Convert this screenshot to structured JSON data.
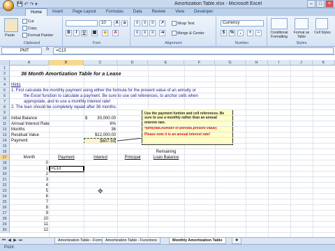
{
  "window": {
    "title": "Amortization Table.xlsx - Microsoft Excel"
  },
  "ribbon_tabs": [
    "Home",
    "Insert",
    "Page Layout",
    "Formulas",
    "Data",
    "Review",
    "View",
    "Developer"
  ],
  "ribbon": {
    "clipboard": {
      "paste": "Paste",
      "cut": "Cut",
      "copy": "Copy",
      "format_painter": "Format Painter",
      "group": "Clipboard"
    },
    "font": {
      "name": "",
      "size": "10",
      "group": "Font"
    },
    "alignment": {
      "wrap": "Wrap Text",
      "merge": "Merge & Center",
      "group": "Alignment"
    },
    "number": {
      "format": "Currency",
      "currency_symbol": "$",
      "percent": "%",
      "group": "Number"
    },
    "styles": {
      "conditional": "Conditional Formatting",
      "format_table": "Format as Table",
      "cell_styles": "Cell Styles",
      "group": "Styles"
    }
  },
  "formula_bar": {
    "name_box": "PMT",
    "fx": "fx",
    "content": "=C13"
  },
  "columns": [
    "A",
    "B",
    "C",
    "D",
    "E",
    "F",
    "G",
    "H",
    "I",
    "J",
    "K"
  ],
  "rows": [
    "1",
    "2",
    "3",
    "4",
    "5",
    "6",
    "7",
    "8",
    "9",
    "10",
    "11",
    "12",
    "13",
    "14",
    "15",
    "16",
    "17",
    "18",
    "19",
    "20",
    "21",
    "22",
    "23",
    "24",
    "25",
    "26",
    "27",
    "28",
    "29",
    "30"
  ],
  "sheet": {
    "title": "36 Month Amortization Table for a Lease",
    "hints": "Hints",
    "hint1a": "1.  First calculate the monthly payment using either the formula for the present value of an annuity or",
    "hint1b": "the Excel function to calculate a payment.  Be sure to use cell references, to anchor cells when",
    "hint1c": "appropriate, and to use a monthly interest rate!",
    "hint2": "2.  The loan should be completely repaid after 36 months.",
    "labels": [
      "Initial Balance",
      "Annual Interest Rate",
      "Months",
      "Residual Value",
      "Payment"
    ],
    "values": [
      "30,000.00",
      "6%",
      "36",
      "$12,000.00",
      "$607.59"
    ],
    "dollar": "$",
    "headers": {
      "month": "Month",
      "payment": "Payment",
      "interest": "Interest",
      "principal": "Principal",
      "remaining1": "Remaining",
      "remaining2": "Loan Balance"
    },
    "months": [
      "0",
      "1",
      "2",
      "3",
      "4",
      "5",
      "6",
      "7",
      "8",
      "9",
      "10",
      "11",
      "12"
    ],
    "edit_value": "=C13"
  },
  "comment": {
    "line1": "Use the payment funtion and cell references.  Be sure to use a monthly rather than an annual interest rate.",
    "formula": "=pmt(rate,number of periods,present value)",
    "note": "Please note it is an annual interest rate!"
  },
  "sheet_tabs": [
    "Amortization Table - Formula",
    "Amortization Table - Functions",
    "Monthly Amortization Table"
  ],
  "status": "Point",
  "colors": {
    "accent": "#f7d892",
    "comment_bg": "#ffffc6",
    "comment_red": "#dd1111"
  }
}
